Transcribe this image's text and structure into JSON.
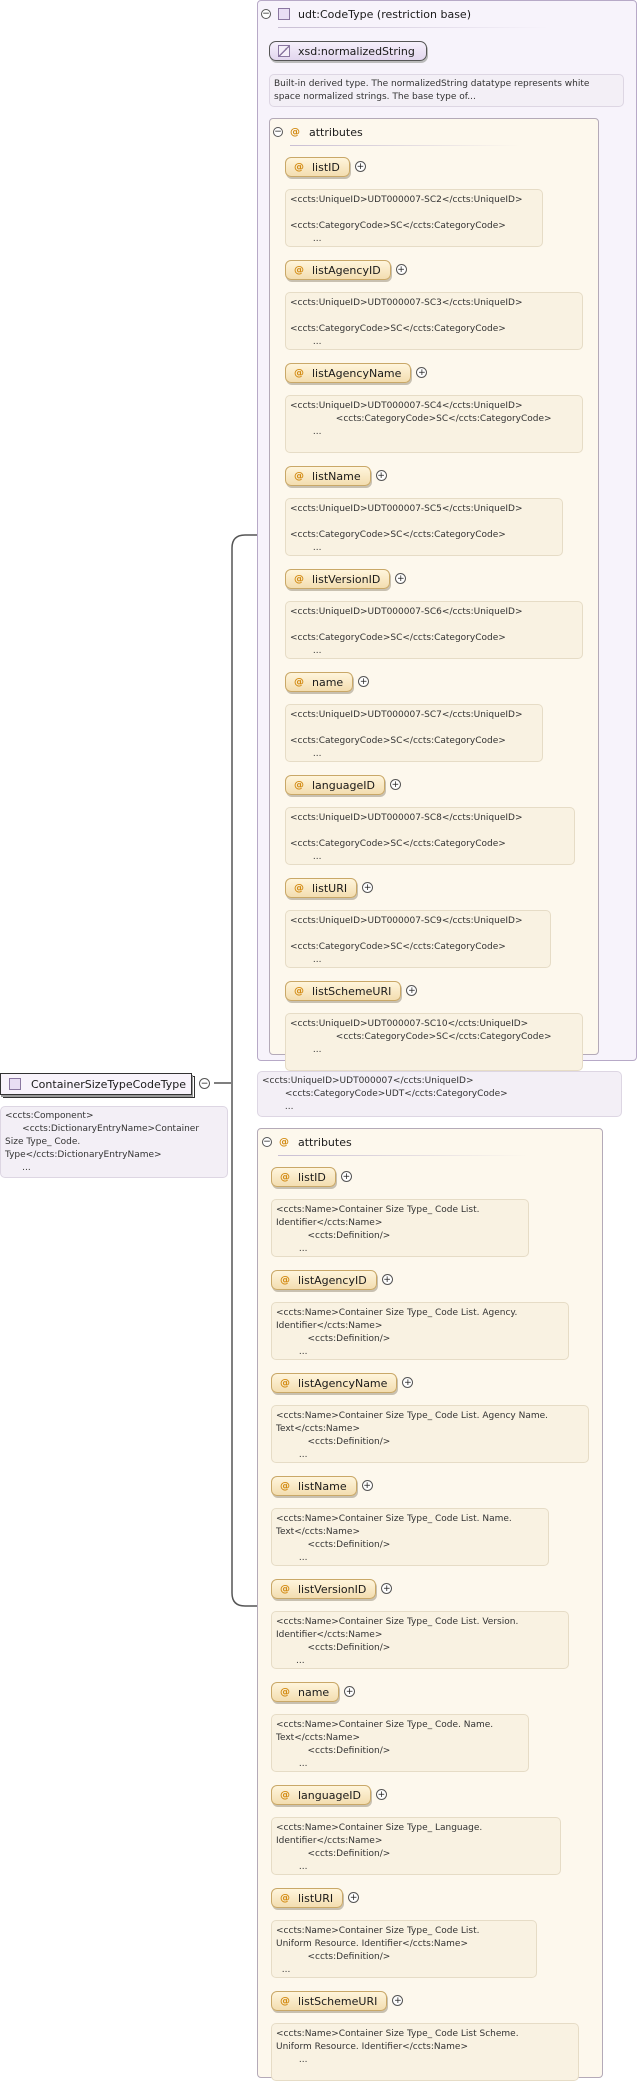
{
  "root": {
    "name": "ContainerSizeTypeCodeType",
    "toggle": "−",
    "doc": "<ccts:Component>\n      <ccts:DictionaryEntryName>Container\nSize Type_ Code.\nType</ccts:DictionaryEntryName>\n      ..."
  },
  "base": {
    "title": "udt:CodeType (restriction base)",
    "toggle": "−",
    "datatype": "xsd:normalizedString",
    "datatype_doc": "Built-in derived type. The normalizedString datatype represents white\nspace normalized strings. The base type of...",
    "attributes_label": "attributes",
    "attributes": [
      {
        "name": "listID",
        "doc": "<ccts:UniqueID>UDT000007-SC2</ccts:UniqueID>\n\n<ccts:CategoryCode>SC</ccts:CategoryCode>\n        ..."
      },
      {
        "name": "listAgencyID",
        "doc": "<ccts:UniqueID>UDT000007-SC3</ccts:UniqueID>\n\n<ccts:CategoryCode>SC</ccts:CategoryCode>\n        ..."
      },
      {
        "name": "listAgencyName",
        "doc": "<ccts:UniqueID>UDT000007-SC4</ccts:UniqueID>\n                <ccts:CategoryCode>SC</ccts:CategoryCode>\n        ..."
      },
      {
        "name": "listName",
        "doc": "<ccts:UniqueID>UDT000007-SC5</ccts:UniqueID>\n\n<ccts:CategoryCode>SC</ccts:CategoryCode>\n        ..."
      },
      {
        "name": "listVersionID",
        "doc": "<ccts:UniqueID>UDT000007-SC6</ccts:UniqueID>\n\n<ccts:CategoryCode>SC</ccts:CategoryCode>\n        ..."
      },
      {
        "name": "name",
        "doc": "<ccts:UniqueID>UDT000007-SC7</ccts:UniqueID>\n\n<ccts:CategoryCode>SC</ccts:CategoryCode>\n        ..."
      },
      {
        "name": "languageID",
        "doc": "<ccts:UniqueID>UDT000007-SC8</ccts:UniqueID>\n\n<ccts:CategoryCode>SC</ccts:CategoryCode>\n        ..."
      },
      {
        "name": "listURI",
        "doc": "<ccts:UniqueID>UDT000007-SC9</ccts:UniqueID>\n\n<ccts:CategoryCode>SC</ccts:CategoryCode>\n        ..."
      },
      {
        "name": "listSchemeURI",
        "doc": "<ccts:UniqueID>UDT000007-SC10</ccts:UniqueID>\n                <ccts:CategoryCode>SC</ccts:CategoryCode>\n        ..."
      }
    ],
    "base_doc": "<ccts:UniqueID>UDT000007</ccts:UniqueID>\n        <ccts:CategoryCode>UDT</ccts:CategoryCode>\n        ..."
  },
  "local": {
    "attributes_label": "attributes",
    "toggle": "−",
    "attributes": [
      {
        "name": "listID",
        "doc": "<ccts:Name>Container Size Type_ Code List.\nIdentifier</ccts:Name>\n           <ccts:Definition/>\n        ..."
      },
      {
        "name": "listAgencyID",
        "doc": "<ccts:Name>Container Size Type_ Code List. Agency.\nIdentifier</ccts:Name>\n           <ccts:Definition/>\n        ..."
      },
      {
        "name": "listAgencyName",
        "doc": "<ccts:Name>Container Size Type_ Code List. Agency Name.\nText</ccts:Name>\n           <ccts:Definition/>\n        ..."
      },
      {
        "name": "listName",
        "doc": "<ccts:Name>Container Size Type_ Code List. Name.\nText</ccts:Name>\n           <ccts:Definition/>\n        ..."
      },
      {
        "name": "listVersionID",
        "doc": "<ccts:Name>Container Size Type_ Code List. Version.\nIdentifier</ccts:Name>\n           <ccts:Definition/>\n       ..."
      },
      {
        "name": "name",
        "doc": "<ccts:Name>Container Size Type_ Code. Name.\nText</ccts:Name>\n           <ccts:Definition/>\n        ..."
      },
      {
        "name": "languageID",
        "doc": "<ccts:Name>Container Size Type_ Language.\nIdentifier</ccts:Name>\n           <ccts:Definition/>\n        ..."
      },
      {
        "name": "listURI",
        "doc": "<ccts:Name>Container Size Type_ Code List.\nUniform Resource. Identifier</ccts:Name>\n           <ccts:Definition/>\n  ..."
      },
      {
        "name": "listSchemeURI",
        "doc": "<ccts:Name>Container Size Type_ Code List Scheme.\nUniform Resource. Identifier</ccts:Name>\n        ..."
      }
    ]
  }
}
